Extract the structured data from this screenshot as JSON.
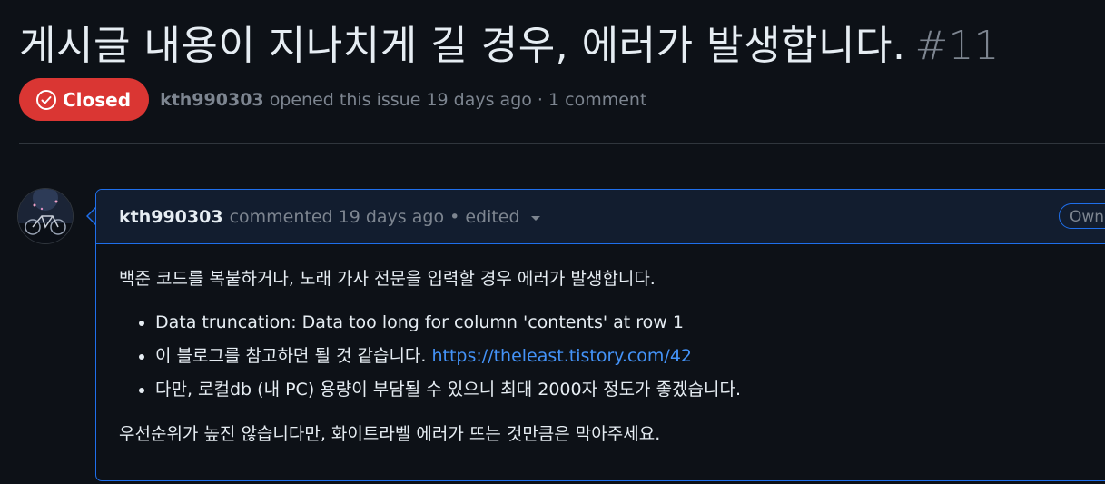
{
  "issue": {
    "title": "게시글 내용이 지나치게 길 경우, 에러가 발생합니다.",
    "number": "#11",
    "state": "Closed",
    "state_color": "#da3633",
    "author": "kth990303",
    "meta": "opened this issue 19 days ago · 1 comment"
  },
  "comment": {
    "author": "kth990303",
    "action": "commented 19 days ago",
    "edited": "• edited",
    "owner_badge": "Owner",
    "intro": "백준 코드를 복붙하거나, 노래 가사 전문을 입력할 경우 에러가 발생합니다.",
    "items": [
      {
        "text": "Data truncation: Data too long for column 'contents' at row 1"
      },
      {
        "text": "이 블로그를 참고하면 될 것 같습니다. ",
        "link": "https://theleast.tistory.com/42"
      },
      {
        "text": "다만, 로컬db (내 PC) 용량이 부담될 수 있으니 최대 2000자 정도가 좋겠습니다."
      }
    ],
    "outro": "우선순위가 높진 않습니다만, 화이트라벨 에러가 뜨는 것만큼은 막아주세요."
  },
  "colors": {
    "background": "#0d1117",
    "accent_border": "#1f6feb",
    "link": "#4493f8",
    "muted": "#7d8590"
  },
  "icons": {
    "state": "closed-check-circle-icon",
    "caret": "caret-down-icon"
  }
}
